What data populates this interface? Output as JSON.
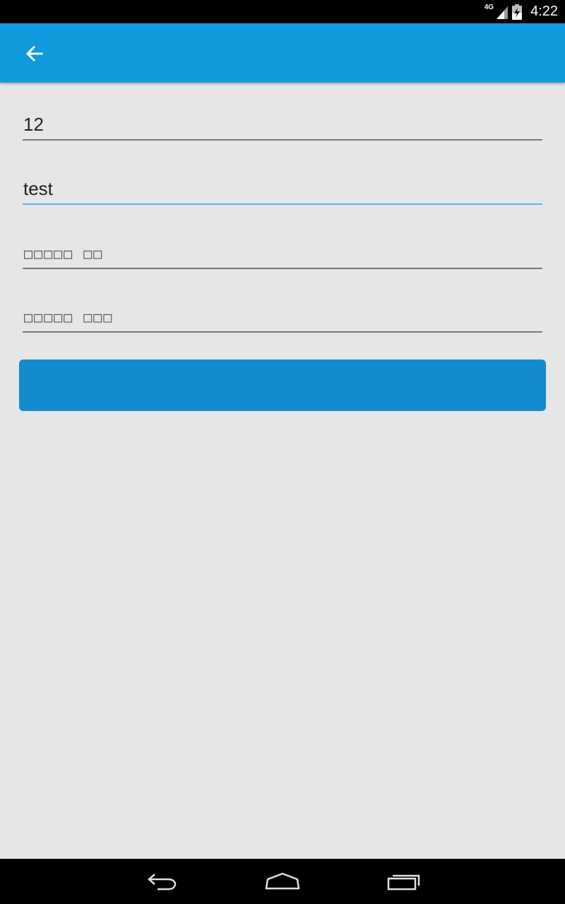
{
  "status_bar": {
    "network_type": "4G",
    "time": "4:22",
    "icons": [
      "signal-icon",
      "battery-charging-icon"
    ]
  },
  "app_bar": {
    "back_icon": "arrow-left-icon",
    "color": "#1199dd"
  },
  "form": {
    "fields": [
      {
        "value": "12",
        "placeholder": ""
      },
      {
        "value": "test",
        "placeholder": ""
      },
      {
        "value": "",
        "placeholder": "□□□□□ □□"
      },
      {
        "value": "",
        "placeholder": "□□□□□ □□□"
      }
    ],
    "submit_label": ""
  },
  "nav_bar": {
    "icons": [
      "back-icon",
      "home-icon",
      "recent-apps-icon"
    ]
  },
  "colors": {
    "accent": "#1199dd",
    "focus_underline": "#4ab8ee",
    "button": "#138bcf",
    "background": "#e6e6e6"
  }
}
